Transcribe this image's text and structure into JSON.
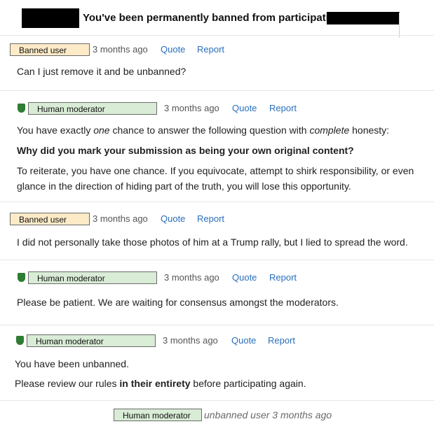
{
  "header": {
    "title": "You've been permanently banned from participating"
  },
  "posts": [
    {
      "author_badge": "Banned user",
      "time": "3 months ago",
      "quote": "Quote",
      "report": "Report",
      "lines": [
        "Can I just remove it and be unbanned?"
      ]
    },
    {
      "author_badge": "Human moderator",
      "time": "3 months ago",
      "quote": "Quote",
      "report": "Report",
      "p1_a": "You have exactly ",
      "p1_em1": "one",
      "p1_b": " chance to answer the following question with ",
      "p1_em2": "complete",
      "p1_c": " honesty:",
      "p2": "Why did you mark your submission as being your own original content?",
      "p3_line1": "To reiterate, you have one chance. If you equivocate, attempt to shirk responsibility, or even",
      "p3_line2": "glance in the direction of hiding part of the truth, you will lose this opportunity."
    },
    {
      "author_badge": "Banned user",
      "time": "3 months ago",
      "quote": "Quote",
      "report": "Report",
      "lines": [
        "I did not personally take those photos of him at a Trump rally, but I lied to spread the word."
      ]
    },
    {
      "author_badge": "Human moderator",
      "time": "3 months ago",
      "quote": "Quote",
      "report": "Report",
      "lines": [
        "Please be patient. We are waiting for consensus amongst the moderators."
      ]
    },
    {
      "author_badge": "Human moderator",
      "time": "3 months ago",
      "quote": "Quote",
      "report": "Report",
      "line1": "You have been unbanned.",
      "line2_a": "Please review our rules ",
      "line2_b": "in their entirety",
      "line2_c": " before participating again."
    }
  ],
  "footer": {
    "badge": "Human moderator",
    "text": "unbanned user 3 months ago"
  },
  "colors": {
    "banned_badge": "#fdebc8",
    "mod_badge": "#d9ecd6",
    "shield": "#2e7d32",
    "link": "#2a6ebb"
  }
}
